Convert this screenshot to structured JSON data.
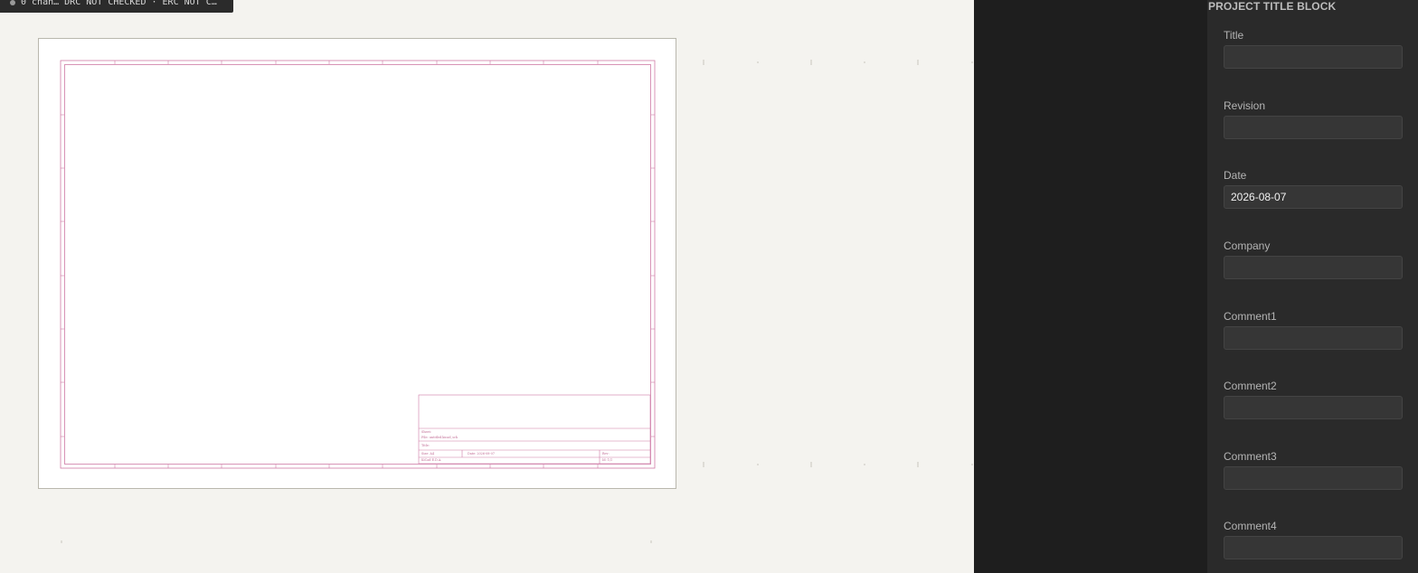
{
  "status_bar": {
    "text": "0 chan…  DRC NOT CHECKED · ERC NOT C…"
  },
  "sheet": {
    "title_block": {
      "sheet_label": "Sheet:",
      "file_label": "File: untitled.kicad_sch",
      "title_label": "Title:",
      "size_label": "Size: A4",
      "date_label": "Date: 2026-08-07",
      "rev_label": "Rev:",
      "kicad_label": "KiCad E.D.A.",
      "id_label": "Id: 1/1"
    }
  },
  "panel": {
    "title": "PROJECT TITLE BLOCK",
    "fields": [
      {
        "label": "Title",
        "value": ""
      },
      {
        "label": "Revision",
        "value": ""
      },
      {
        "label": "Date",
        "value": "2026-08-07"
      },
      {
        "label": "Company",
        "value": ""
      },
      {
        "label": "Comment1",
        "value": ""
      },
      {
        "label": "Comment2",
        "value": ""
      },
      {
        "label": "Comment3",
        "value": ""
      },
      {
        "label": "Comment4",
        "value": ""
      }
    ]
  }
}
